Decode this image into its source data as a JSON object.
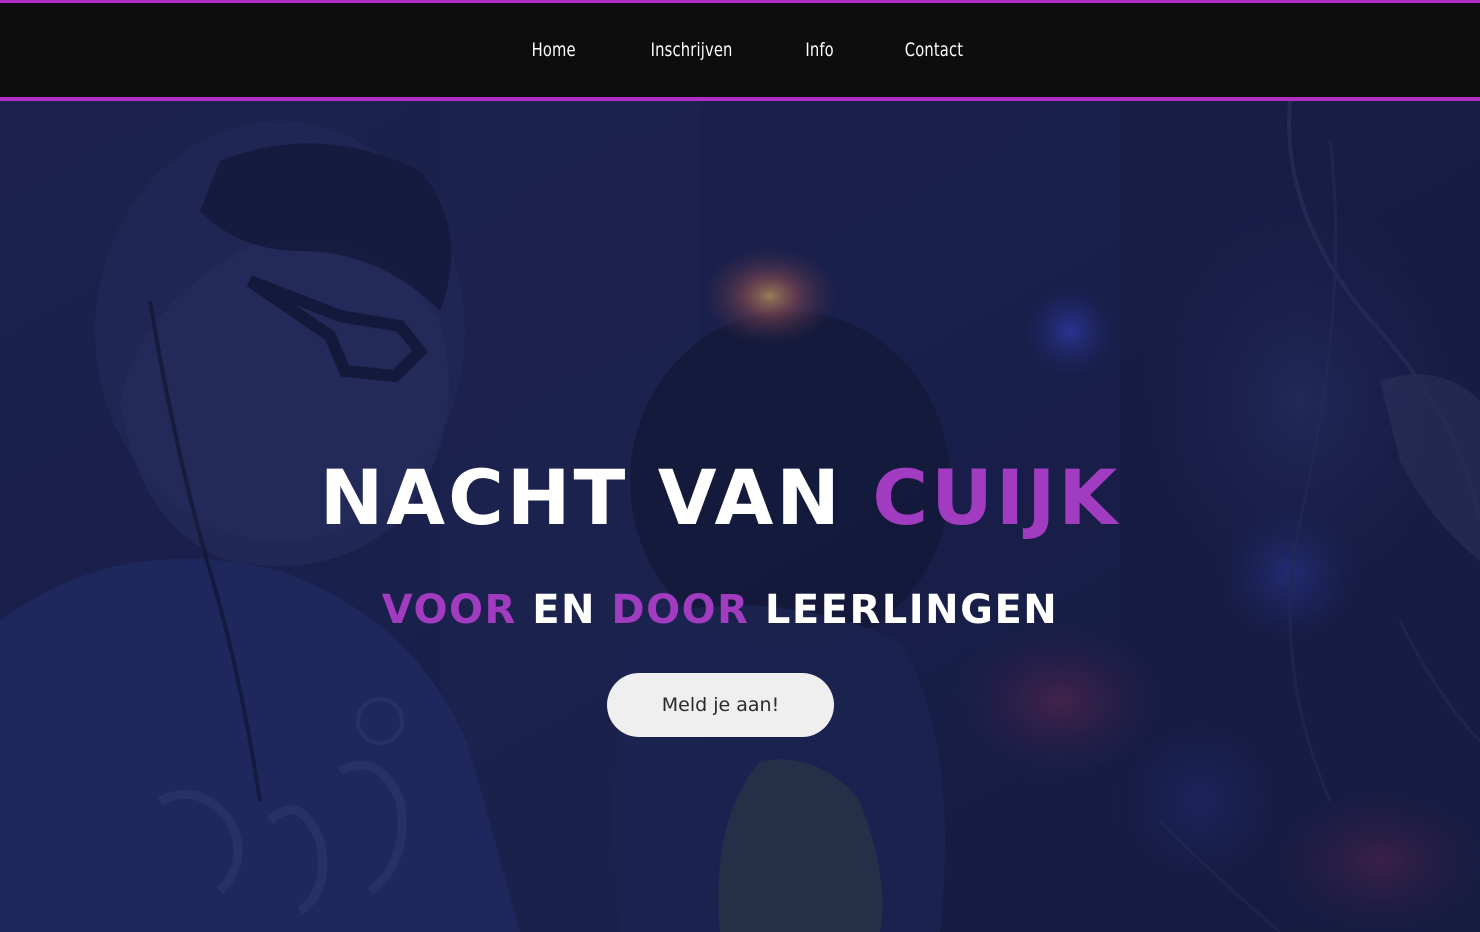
{
  "nav": {
    "items": [
      {
        "label": "Home"
      },
      {
        "label": "Inschrijven"
      },
      {
        "label": "Info"
      },
      {
        "label": "Contact"
      }
    ]
  },
  "hero": {
    "title": {
      "part1": "NACHT VAN ",
      "part2": "CUIJK"
    },
    "subtitle": {
      "part1": "VOOR",
      "part2": " EN ",
      "part3": "DOOR",
      "part4": " LEERLINGEN"
    },
    "cta_label": "Meld je aan!"
  },
  "colors": {
    "accent": "#a13bbf",
    "border_accent": "#b02ec4",
    "nav_background": "#0d0d0d",
    "button_background": "#efefef",
    "text": "#ffffff"
  }
}
